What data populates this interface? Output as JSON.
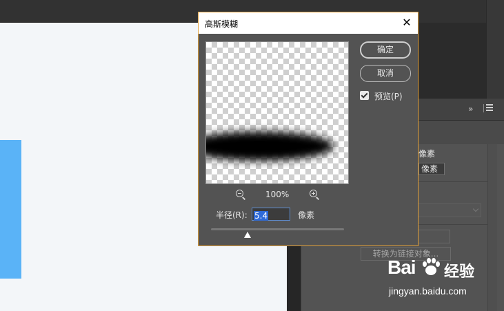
{
  "dialog": {
    "title": "高斯模糊",
    "close_glyph": "✕",
    "ok_label": "确定",
    "cancel_label": "取消",
    "preview_label": "预览(P)",
    "preview_checked": true,
    "zoom_level": "100%",
    "radius_label": "半径(R):",
    "radius_value": "5.4",
    "radius_unit": "像素",
    "accent_border": "#e2a039"
  },
  "properties_panel": {
    "collapse_glyph": "»",
    "unit_label_1": "像素",
    "unit_field_value": "像素",
    "partial_button_text": "",
    "convert_button_label": "转换为链接对象..."
  },
  "watermark": {
    "logo": "Bai",
    "logo_suffix": "经验",
    "url": "jingyan.baidu.com"
  },
  "colors": {
    "canvas_bg": "#f3f6f9",
    "shape_blue": "#5ab3f7",
    "panel_bg": "#535353"
  }
}
